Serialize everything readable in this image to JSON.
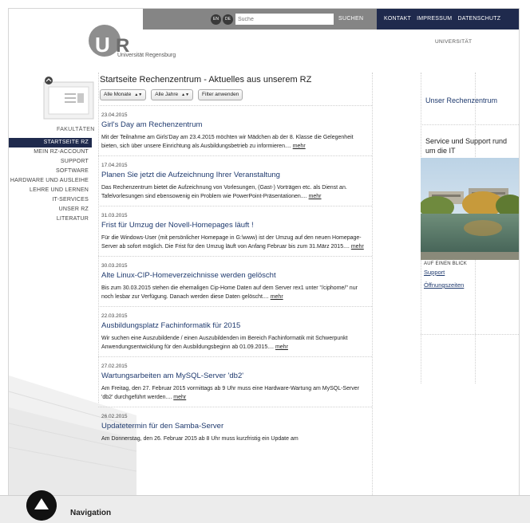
{
  "topbar": {
    "lang_en": "EN",
    "lang_de": "DE",
    "search_placeholder": "Suche",
    "search_button": "SUCHEN",
    "links": [
      "KONTAKT",
      "IMPRESSUM",
      "DATENSCHUTZ"
    ],
    "university_link": "UNIVERSITÄT"
  },
  "logo": {
    "letters": "UR",
    "subtitle": "Universität Regensburg"
  },
  "sidebar": {
    "faculty_label": "FAKULTÄTEN",
    "items": [
      {
        "label": "STARTSEITE RZ",
        "active": true
      },
      {
        "label": "MEIN RZ-ACCOUNT"
      },
      {
        "label": "SUPPORT"
      },
      {
        "label": "SOFTWARE"
      },
      {
        "label": "HARDWARE UND AUSLEIHE"
      },
      {
        "label": "LEHRE UND LERNEN"
      },
      {
        "label": "IT-SERVICES"
      },
      {
        "label": "UNSER RZ"
      },
      {
        "label": "LITERATUR"
      }
    ]
  },
  "main": {
    "title": "Startseite Rechenzentrum - Aktuelles aus unserem RZ",
    "filter_month": "Alle Monate",
    "filter_year": "Alle Jahre",
    "filter_button": "Filter anwenden",
    "more_label": "mehr",
    "news": [
      {
        "date": "23.04.2015",
        "title": "Girl's Day am Rechenzentrum",
        "text": "Mit der Teilnahme am Girls'Day am 23.4.2015 möchten wir Mädchen ab der 8. Klasse die Gelegenheit bieten, sich über unsere Einrichtung als Ausbildungsbetrieb zu informieren...."
      },
      {
        "date": "17.04.2015",
        "title": "Planen Sie jetzt die Aufzeichnung Ihrer Veranstaltung",
        "text": "Das Rechenzentrum bietet die Aufzeichnung von Vorlesungen, (Gast-) Vorträgen etc. als Dienst an. Tafelvorlesungen sind ebensowenig ein Problem wie PowerPoint-Präsentationen...."
      },
      {
        "date": "31.03.2015",
        "title": "Frist für Umzug der Novell-Homepages läuft !",
        "text": "Für die Windows-User (mit persönlicher Homepage in G:\\www) ist der Umzug auf den neuen Homepage-Server ab sofort möglich. Die Frist für den Umzug läuft von Anfang Februar bis zum 31.März 2015...."
      },
      {
        "date": "30.03.2015",
        "title": "Alte Linux-CIP-Homeverzeichnisse werden gelöscht",
        "text": "Bis zum 30.03.2015 stehen die ehemaligen Cip-Home Daten auf dem Server rex1 unter \"/ciphome/\" nur noch lesbar zur Verfügung. Danach werden diese Daten gelöscht...."
      },
      {
        "date": "22.03.2015",
        "title": "Ausbildungsplatz Fachinformatik für 2015",
        "text": "Wir suchen eine Auszubildende / einen Auszubildenden im Bereich Fachinformatik mit Schwerpunkt Anwendungsentwicklung für den Ausbildungsbeginn ab 01.09.2015...."
      },
      {
        "date": "27.02.2015",
        "title": "Wartungsarbeiten am MySQL-Server 'db2'",
        "text": "Am Freitag, den 27. Februar 2015 vormittags ab 9 Uhr muss eine Hardware-Wartung am MySQL-Server 'db2' durchgeführt werden...."
      },
      {
        "date": "26.02.2015",
        "title": "Updatetermin für den Samba-Server",
        "text": "Am Donnerstag, den 26. Februar 2015 ab 8 Uhr muss kurzfristig ein Update am"
      }
    ]
  },
  "right": {
    "title1": "Unser Rechenzentrum",
    "title2": "Service und Support rund um die IT",
    "glance": "AUF EINEN BLICK",
    "link_support": "Support",
    "link_hours": "Öffnungszeiten"
  },
  "bottom": {
    "label": "Navigation"
  },
  "colors": {
    "navy": "#1f2a4d",
    "gray_bar": "#858585",
    "link_blue": "#1f3a6e"
  }
}
